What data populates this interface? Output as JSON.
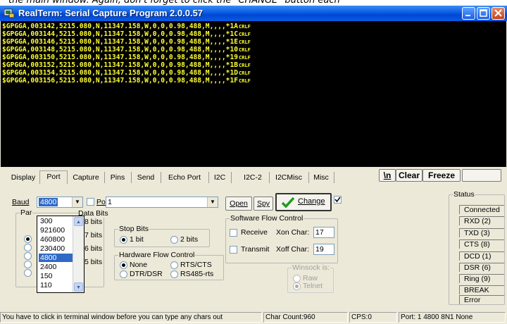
{
  "caption": "the main window. Again, don't forget to click the \"CHANGE\" button each",
  "window": {
    "title": "RealTerm: Serial Capture Program 2.0.0.57"
  },
  "terminal": {
    "lines": [
      "$GPGGA,003142,5215.080,N,11347.158,W,0,0,0.98,488,M,,,,*1A",
      "$GPGGA,003144,5215.080,N,11347.158,W,0,0,0.98,488,M,,,,*1C",
      "$GPGGA,003146,5215.080,N,11347.158,W,0,0,0.98,488,M,,,,*1E",
      "$GPGGA,003148,5215.080,N,11347.158,W,0,0,0.98,488,M,,,,*10",
      "$GPGGA,003150,5215.080,N,11347.158,W,0,0,0.98,488,M,,,,*19",
      "$GPGGA,003152,5215.080,N,11347.158,W,0,0,0.98,488,M,,,,*1B",
      "$GPGGA,003154,5215.080,N,11347.158,W,0,0,0.98,488,M,,,,*1D",
      "$GPGGA,003156,5215.080,N,11347.158,W,0,0,0.98,488,M,,,,*1F"
    ],
    "eol": "CRLF",
    "text_color": "#ffff33",
    "background": "#000000"
  },
  "tabs": [
    "Display",
    "Port",
    "Capture",
    "Pins",
    "Send",
    "Echo Port",
    "I2C",
    "I2C-2",
    "I2CMisc",
    "Misc"
  ],
  "active_tab": "Port",
  "toolbar": {
    "newline": "\\n",
    "clear": "Clear",
    "freeze": "Freeze"
  },
  "port": {
    "baud_label": "Baud",
    "baud_value": "4800",
    "port_label": "Port",
    "port_value": "1",
    "open": "Open",
    "spy": "Spy",
    "change": "Change",
    "baud_options": [
      "300",
      "921600",
      "460800",
      "230400",
      "4800",
      "2400",
      "150",
      "110"
    ],
    "baud_selected": "4800",
    "parity_label": "Par",
    "data_bits_label": "Data Bits",
    "data_bits": [
      "8 bits",
      "7 bits",
      "6 bits",
      "5 bits"
    ],
    "stop_bits_label": "Stop Bits",
    "stop_bits": [
      "1 bit",
      "2 bits"
    ],
    "flow_label": "Hardware Flow Control",
    "flow_options": [
      "None",
      "RTS/CTS",
      "DTR/DSR",
      "RS485-rts"
    ],
    "sw_flow_label": "Software Flow Control",
    "receive_label": "Receive",
    "xon_label": "Xon Char:",
    "xon_value": "17",
    "transmit_label": "Transmit",
    "xoff_label": "Xoff Char:",
    "xoff_value": "19",
    "winsock_label": "Winsock is:",
    "winsock_options": [
      "Raw",
      "Telnet"
    ]
  },
  "status": {
    "label": "Status",
    "items": [
      "Connected",
      "RXD (2)",
      "TXD (3)",
      "CTS (8)",
      "DCD (1)",
      "DSR (6)",
      "Ring (9)",
      "BREAK",
      "Error"
    ]
  },
  "statusbar": {
    "hint": "You have to click in terminal window before you can type any chars out",
    "char_count": "Char Count:960",
    "cps": "CPS:0",
    "port_info": "Port: 1 4800 8N1 None"
  },
  "colors": {
    "titlebar": "#0a5ce0",
    "change_check": "#1f9a1f",
    "selection": "#316ac5"
  }
}
